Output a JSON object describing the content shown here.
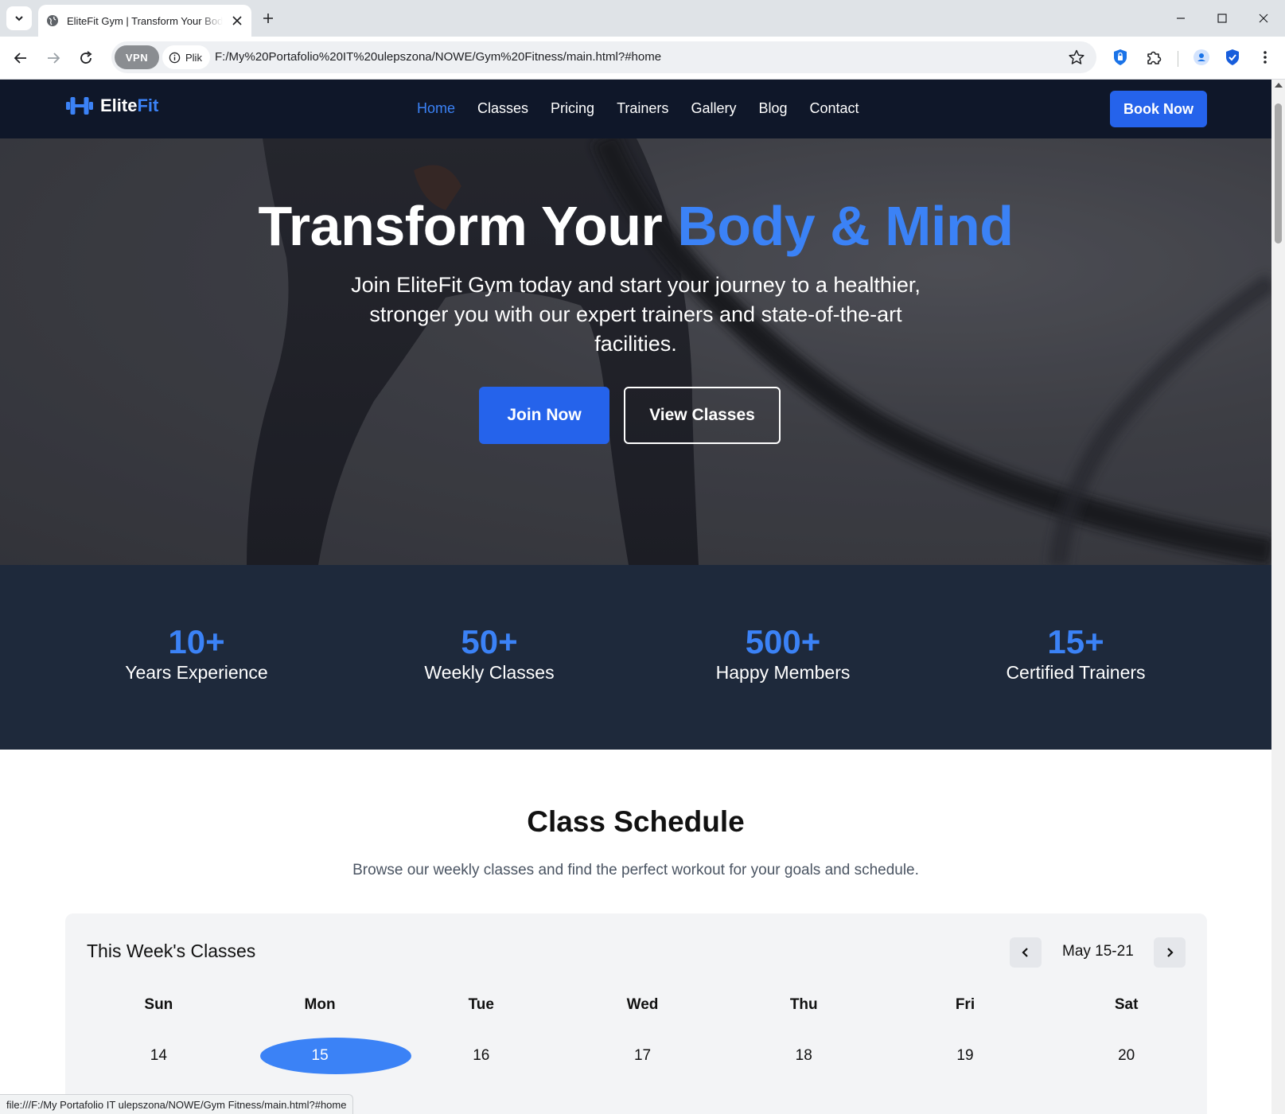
{
  "browser": {
    "tab_title": "EliteFit Gym | Transform Your Body",
    "vpn_label": "VPN",
    "site_chip_label": "Plik",
    "url": "F:/My%20Portafolio%20IT%20ulepszona/NOWE/Gym%20Fitness/main.html?#home",
    "status_url": "file:///F:/My Portafolio IT ulepszona/NOWE/Gym Fitness/main.html?#home"
  },
  "nav": {
    "brand_prefix": "Elite",
    "brand_suffix": "Fit",
    "links": [
      {
        "label": "Home",
        "active": true
      },
      {
        "label": "Classes"
      },
      {
        "label": "Pricing"
      },
      {
        "label": "Trainers"
      },
      {
        "label": "Gallery"
      },
      {
        "label": "Blog"
      },
      {
        "label": "Contact"
      }
    ],
    "cta_label": "Book Now"
  },
  "hero": {
    "title_plain": "Transform Your ",
    "title_highlight": "Body & Mind",
    "subtitle": "Join EliteFit Gym today and start your journey to a healthier, stronger you with our expert trainers and state-of-the-art facilities.",
    "primary_button": "Join Now",
    "secondary_button": "View Classes"
  },
  "stats": [
    {
      "value": "10+",
      "label": "Years Experience"
    },
    {
      "value": "50+",
      "label": "Weekly Classes"
    },
    {
      "value": "500+",
      "label": "Happy Members"
    },
    {
      "value": "15+",
      "label": "Certified Trainers"
    }
  ],
  "schedule": {
    "title": "Class Schedule",
    "subtitle": "Browse our weekly classes and find the perfect workout for your goals and schedule.",
    "calendar_heading": "This Week's Classes",
    "range": "May 15-21",
    "days": [
      "Sun",
      "Mon",
      "Tue",
      "Wed",
      "Thu",
      "Fri",
      "Sat"
    ],
    "dates": [
      "14",
      "15",
      "16",
      "17",
      "18",
      "19",
      "20"
    ],
    "selected_date": "15"
  },
  "colors": {
    "accent": "#3b82f6",
    "button_blue": "#2563eb",
    "nav_bg": "#0f1729",
    "stats_bg": "#1e293b"
  },
  "icons": [
    "tab-menu-icon",
    "globe-icon",
    "close-icon",
    "plus-icon",
    "minimize-icon",
    "maximize-icon",
    "back-icon",
    "forward-icon",
    "reload-icon",
    "info-icon",
    "star-icon",
    "shield-extension-icon",
    "puzzle-icon",
    "profile-icon",
    "bitwarden-icon",
    "kebab-menu-icon",
    "dumbbell-icon",
    "chevron-left-icon",
    "chevron-right-icon"
  ]
}
